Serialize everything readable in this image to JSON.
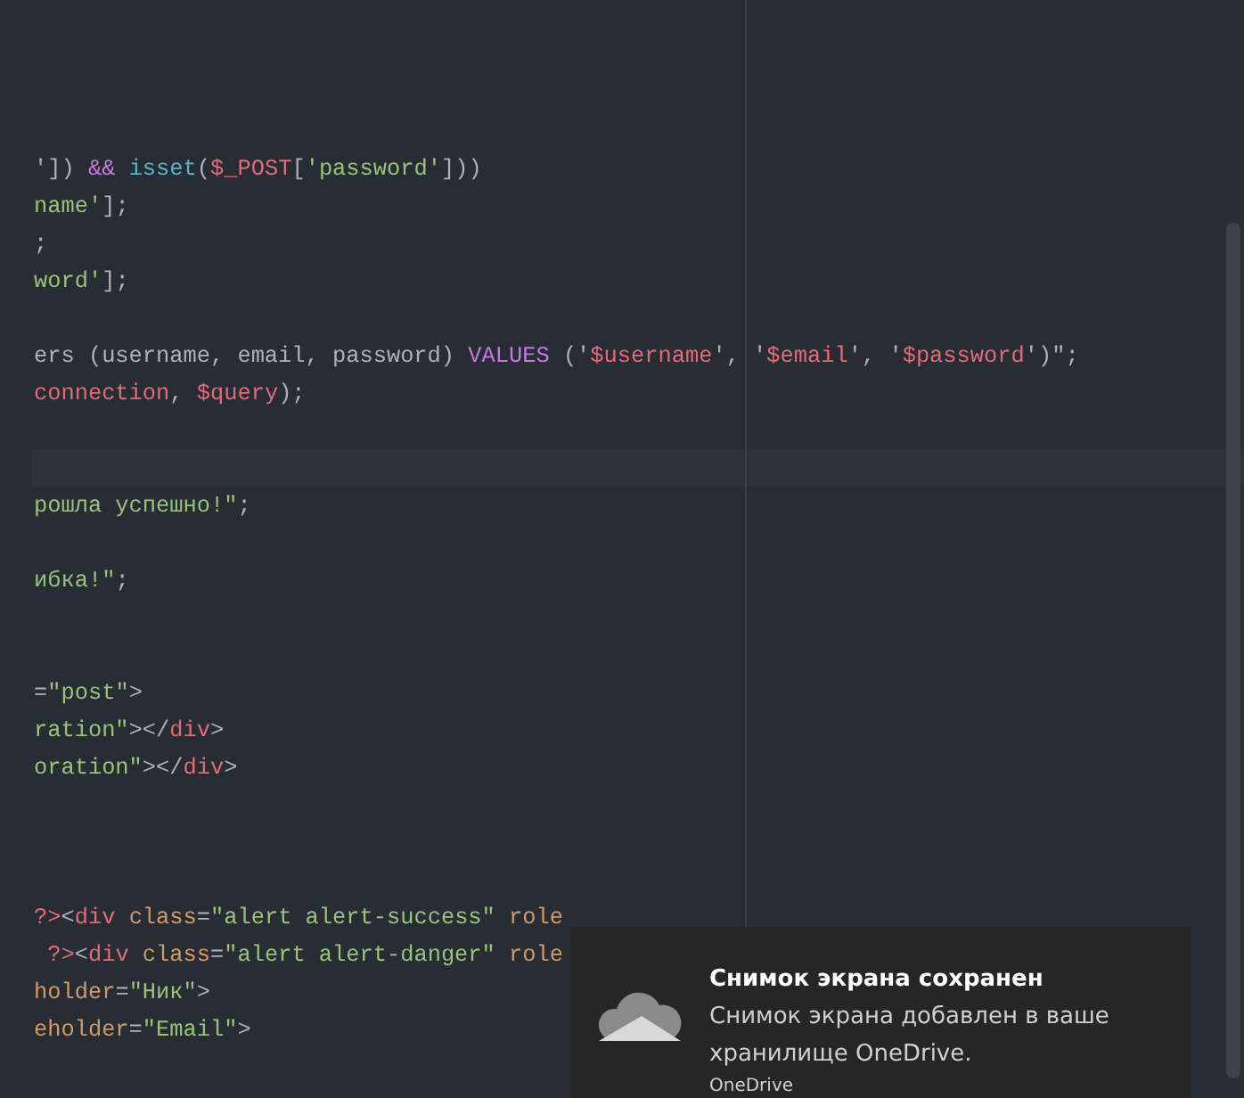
{
  "editor": {
    "lines": [
      {
        "current": false
      },
      {
        "current": false
      },
      {
        "current": false
      },
      {
        "current": false
      },
      {
        "current": false,
        "tokens": [
          {
            "t": "']) ",
            "kind": "plain"
          },
          {
            "t": "&&",
            "kind": "keyword"
          },
          {
            "t": " isset",
            "kind": "func"
          },
          {
            "t": "(",
            "kind": "plain"
          },
          {
            "t": "$_POST",
            "kind": "var"
          },
          {
            "t": "[",
            "kind": "plain"
          },
          {
            "t": "'password'",
            "kind": "string"
          },
          {
            "t": "]))",
            "kind": "plain"
          }
        ]
      },
      {
        "current": false,
        "tokens": [
          {
            "t": "name'",
            "kind": "string"
          },
          {
            "t": "];",
            "kind": "plain"
          }
        ]
      },
      {
        "current": false,
        "tokens": [
          {
            "t": ";",
            "kind": "plain"
          }
        ]
      },
      {
        "current": false,
        "tokens": [
          {
            "t": "word'",
            "kind": "string"
          },
          {
            "t": "];",
            "kind": "plain"
          }
        ]
      },
      {
        "current": false
      },
      {
        "current": false,
        "tokens": [
          {
            "t": "ers (username, email, password) ",
            "kind": "plain"
          },
          {
            "t": "VALUES",
            "kind": "keyword"
          },
          {
            "t": " ('",
            "kind": "plain"
          },
          {
            "t": "$username",
            "kind": "var"
          },
          {
            "t": "', '",
            "kind": "plain"
          },
          {
            "t": "$email",
            "kind": "var"
          },
          {
            "t": "', '",
            "kind": "plain"
          },
          {
            "t": "$password",
            "kind": "var"
          },
          {
            "t": "')\";",
            "kind": "plain"
          }
        ]
      },
      {
        "current": false,
        "tokens": [
          {
            "t": "connection",
            "kind": "var"
          },
          {
            "t": ", ",
            "kind": "plain"
          },
          {
            "t": "$query",
            "kind": "var"
          },
          {
            "t": ");",
            "kind": "plain"
          }
        ]
      },
      {
        "current": false
      },
      {
        "current": true
      },
      {
        "current": false,
        "tokens": [
          {
            "t": "рошла успешно!\"",
            "kind": "string"
          },
          {
            "t": ";",
            "kind": "plain"
          }
        ]
      },
      {
        "current": false
      },
      {
        "current": false,
        "tokens": [
          {
            "t": "ибка!\"",
            "kind": "string"
          },
          {
            "t": ";",
            "kind": "plain"
          }
        ]
      },
      {
        "current": false
      },
      {
        "current": false
      },
      {
        "current": false,
        "tokens": [
          {
            "t": "=",
            "kind": "plain"
          },
          {
            "t": "\"post\"",
            "kind": "string"
          },
          {
            "t": ">",
            "kind": "plain"
          }
        ]
      },
      {
        "current": false,
        "tokens": [
          {
            "t": "ration\"",
            "kind": "string"
          },
          {
            "t": "></",
            "kind": "plain"
          },
          {
            "t": "div",
            "kind": "tag"
          },
          {
            "t": ">",
            "kind": "plain"
          }
        ]
      },
      {
        "current": false,
        "tokens": [
          {
            "t": "oration\"",
            "kind": "string"
          },
          {
            "t": "></",
            "kind": "plain"
          },
          {
            "t": "div",
            "kind": "tag"
          },
          {
            "t": ">",
            "kind": "plain"
          }
        ]
      },
      {
        "current": false
      },
      {
        "current": false
      },
      {
        "current": false
      },
      {
        "current": false,
        "tokens": [
          {
            "t": "?>",
            "kind": "var"
          },
          {
            "t": "<",
            "kind": "plain"
          },
          {
            "t": "div",
            "kind": "tag"
          },
          {
            "t": " class",
            "kind": "attr"
          },
          {
            "t": "=",
            "kind": "plain"
          },
          {
            "t": "\"alert alert-success\"",
            "kind": "string"
          },
          {
            "t": " role",
            "kind": "attr"
          }
        ]
      },
      {
        "current": false,
        "tokens": [
          {
            "t": " ?>",
            "kind": "var"
          },
          {
            "t": "<",
            "kind": "plain"
          },
          {
            "t": "div",
            "kind": "tag"
          },
          {
            "t": " class",
            "kind": "attr"
          },
          {
            "t": "=",
            "kind": "plain"
          },
          {
            "t": "\"alert alert-danger\"",
            "kind": "string"
          },
          {
            "t": " role",
            "kind": "attr"
          }
        ]
      },
      {
        "current": false,
        "tokens": [
          {
            "t": "holder",
            "kind": "attr"
          },
          {
            "t": "=",
            "kind": "plain"
          },
          {
            "t": "\"Ник\"",
            "kind": "string"
          },
          {
            "t": ">",
            "kind": "plain"
          }
        ]
      },
      {
        "current": false,
        "tokens": [
          {
            "t": "eholder",
            "kind": "attr"
          },
          {
            "t": "=",
            "kind": "plain"
          },
          {
            "t": "\"Email\"",
            "kind": "string"
          },
          {
            "t": ">",
            "kind": "plain"
          }
        ]
      }
    ]
  },
  "toast": {
    "title": "Снимок экрана сохранен",
    "message": "Снимок экрана добавлен в ваше хранилище OneDrive.",
    "source": "OneDrive"
  }
}
